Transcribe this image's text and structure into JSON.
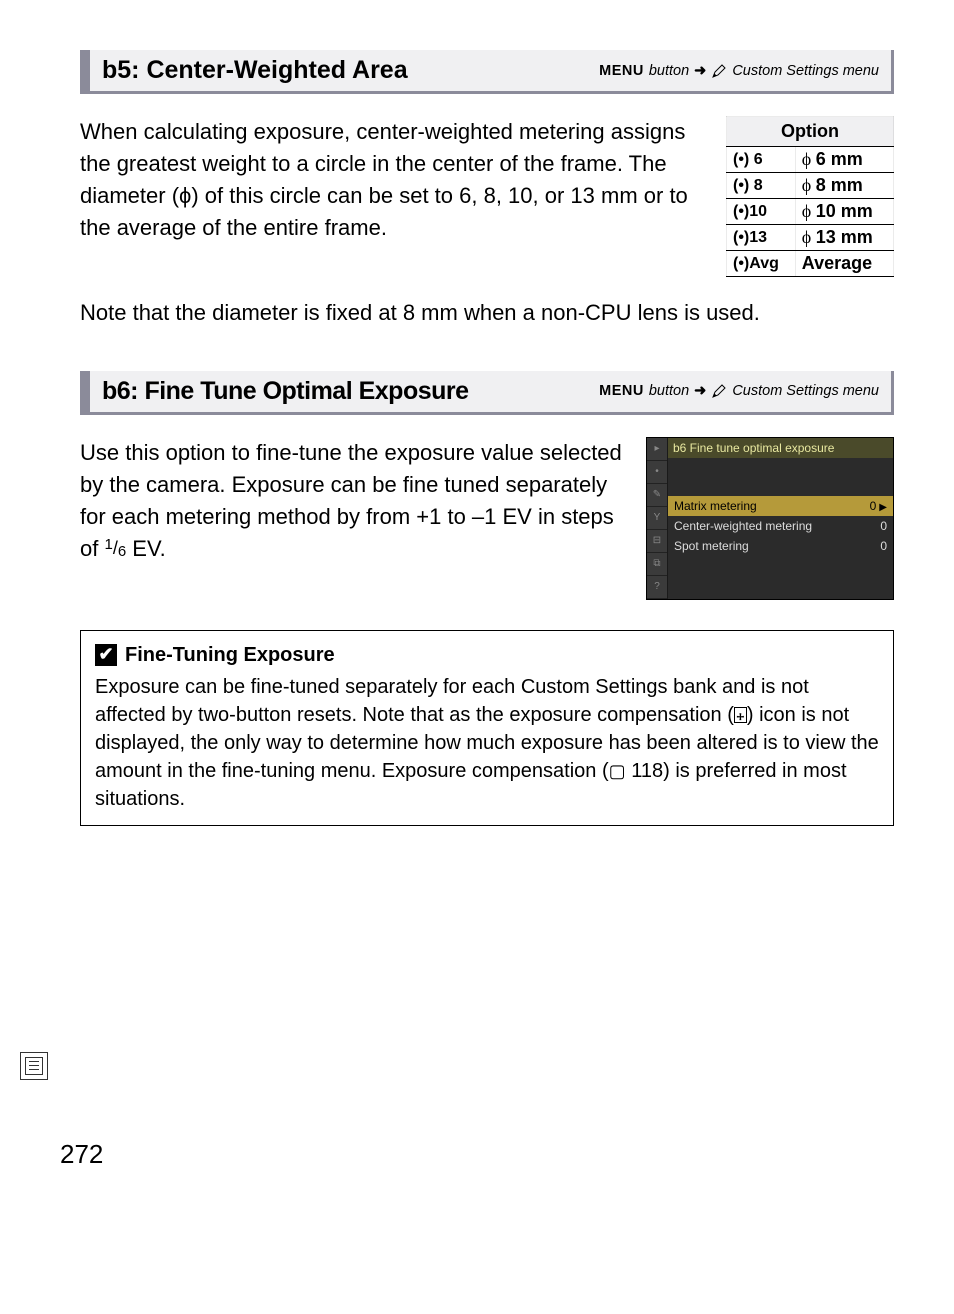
{
  "b5": {
    "title": "b5: Center-Weighted Area",
    "path_menu": "MENU",
    "path_button": "button",
    "path_menu_name": "Custom Settings menu",
    "body": "When calculating exposure, center-weighted metering assigns the greatest weight to a circle in the center of the frame.  The diameter (ϕ) of this circle can be set to 6, 8, 10, or 13 mm or to the average of the entire frame.",
    "note": "Note that the diameter is fixed at 8 mm when a non-CPU lens is used.",
    "options_header": "Option",
    "options": [
      {
        "code": "(•) 6",
        "phi": "ϕ",
        "val": "6 mm"
      },
      {
        "code": "(•) 8",
        "phi": "ϕ",
        "val": "8 mm"
      },
      {
        "code": "(•)10",
        "phi": "ϕ",
        "val": "10 mm"
      },
      {
        "code": "(•)13",
        "phi": "ϕ",
        "val": "13 mm"
      },
      {
        "code": "(•)Avg",
        "phi": "",
        "val": "Average"
      }
    ]
  },
  "b6": {
    "title": "b6: Fine Tune Optimal Exposure",
    "path_menu": "MENU",
    "path_button": "button",
    "path_menu_name": "Custom Settings menu",
    "body_pre": "Use this option to fine-tune the exposure value selected by the camera.  Exposure can be fine tuned separately for each metering method by from +1 to –1 EV in steps of ",
    "frac_num": "1",
    "frac_den": "6",
    "body_post": " EV.",
    "screen": {
      "title": "b6 Fine tune optimal exposure",
      "rows": [
        {
          "label": "Matrix metering",
          "val": "0",
          "sel": true
        },
        {
          "label": "Center-weighted metering",
          "val": "0",
          "sel": false
        },
        {
          "label": "Spot metering",
          "val": "0",
          "sel": false
        }
      ]
    }
  },
  "info": {
    "heading": "Fine-Tuning Exposure",
    "body_1": "Exposure can be fine-tuned separately for each Custom Settings bank and is not affected by two-button resets.  Note that as the exposure compensation (",
    "body_2": ") icon is not displayed, the only way to determine how much exposure has been altered is to view the amount in the fine-tuning menu.  Exposure compensation (",
    "page_ref": " 118",
    "body_3": ") is preferred in most situations."
  },
  "page_number": "272"
}
